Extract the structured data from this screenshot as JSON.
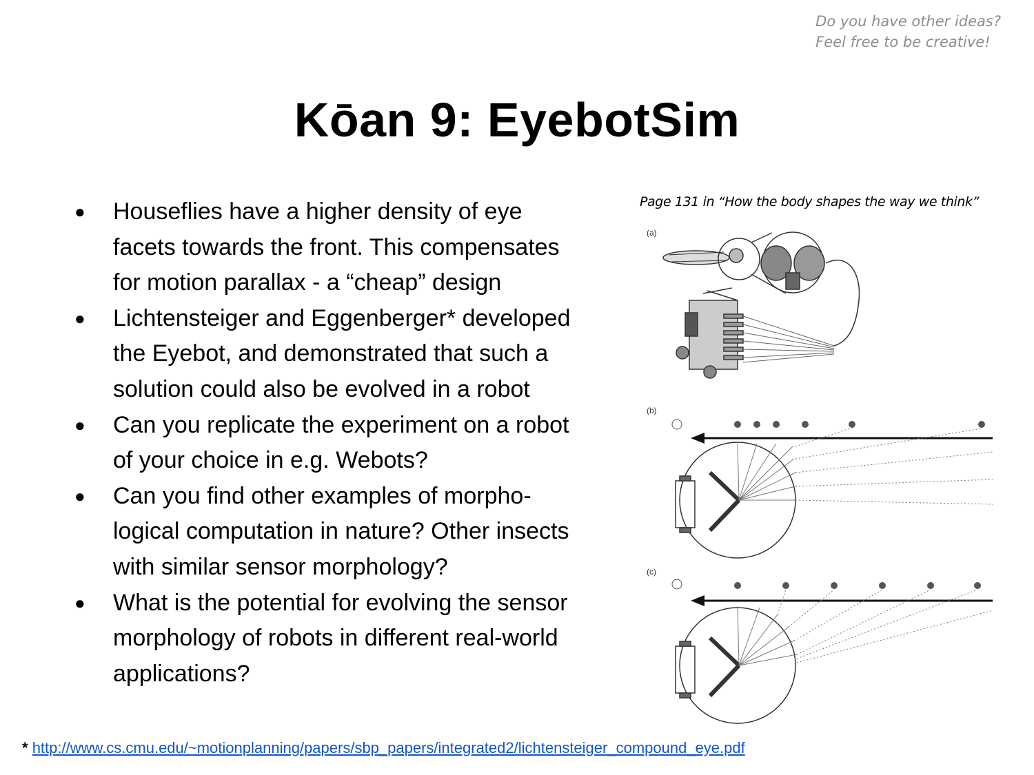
{
  "corner_note": {
    "line1": "Do you have other ideas?",
    "line2": "Feel free to be creative!"
  },
  "title": "Kōan 9: EyebotSim",
  "bullets": [
    {
      "lines": [
        "Houseflies have a higher density of eye",
        "facets towards the front. This compensates",
        "for motion parallax -  a “cheap” design"
      ]
    },
    {
      "lines": [
        "Lichtensteiger and Eggenberger* developed",
        "the Eyebot, and demonstrated that such a",
        "solution could also be evolved in a robot"
      ]
    },
    {
      "lines": [
        "Can you replicate the experiment on a robot",
        "of your choice in e.g. Webots?"
      ]
    },
    {
      "lines": [
        "Can you find other examples of morpho-",
        "logical computation in nature? Other insects",
        "with similar sensor morphology?"
      ]
    },
    {
      "lines": [
        "What is the potential for evolving the sensor",
        "morphology of robots in different real-world",
        "applications?"
      ]
    }
  ],
  "figure": {
    "caption": "Page 131 in “How the body shapes the way we think”",
    "panel_labels": [
      "(a)",
      "(b)",
      "(c)"
    ]
  },
  "footnote": {
    "marker": "*",
    "link_text": "http://www.cs.cmu.edu/~motionplanning/papers/sbp_papers/integrated2/lichtensteiger_compound_eye.pdf"
  }
}
